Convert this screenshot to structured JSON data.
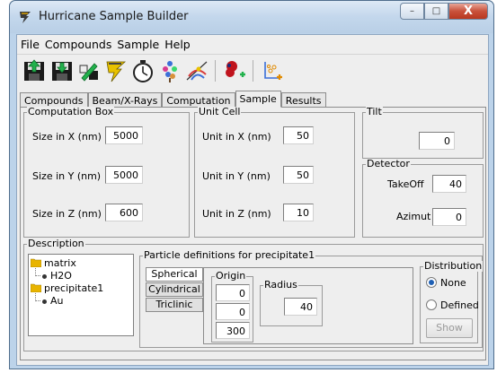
{
  "window": {
    "title": "Hurricane Sample Builder",
    "app_icon": "hurricane-logo-icon",
    "caption_buttons": {
      "minimize": "–",
      "maximize": "□",
      "close": "X"
    }
  },
  "menu": [
    "File",
    "Compounds",
    "Sample",
    "Help"
  ],
  "toolbar": [
    {
      "icon": "save-green-icon"
    },
    {
      "icon": "save-black-icon"
    },
    {
      "icon": "edit-green-icon"
    },
    {
      "icon": "hurricane-lightning-icon"
    },
    {
      "icon": "stopwatch-icon"
    },
    {
      "icon": "molecule-tree-icon"
    },
    {
      "icon": "trajectory-icon"
    },
    {
      "icon": "add-particle-icon"
    },
    {
      "icon": "add-distribution-icon"
    }
  ],
  "tabs": [
    "Compounds",
    "Beam/X-Rays",
    "Computation",
    "Sample",
    "Results"
  ],
  "active_tab": "Sample",
  "computation_box": {
    "title": "Computation Box",
    "fields": [
      {
        "label": "Size in X (nm)",
        "value": "5000"
      },
      {
        "label": "Size in Y (nm)",
        "value": "5000"
      },
      {
        "label": "Size in Z (nm)",
        "value": "600"
      }
    ]
  },
  "unit_cell": {
    "title": "Unit Cell",
    "fields": [
      {
        "label": "Unit in X (nm)",
        "value": "50"
      },
      {
        "label": "Unit in Y (nm)",
        "value": "50"
      },
      {
        "label": "Unit in Z (nm)",
        "value": "10"
      }
    ]
  },
  "tilt": {
    "title": "Tilt",
    "value": "0"
  },
  "detector": {
    "title": "Detector",
    "takeoff_label": "TakeOff",
    "takeoff_value": "40",
    "azimut_label": "Azimut",
    "azimut_value": "0"
  },
  "description": {
    "title": "Description",
    "tree": [
      {
        "label": "matrix",
        "children": [
          "H2O"
        ]
      },
      {
        "label": "precipitate1",
        "children": [
          "Au"
        ]
      }
    ]
  },
  "particle": {
    "title": "Particle definitions for precipitate1",
    "shapes": [
      "Spherical",
      "Cylindrical",
      "Triclinic"
    ],
    "active_shape": "Spherical",
    "origin_title": "Origin",
    "origin": [
      "0",
      "0",
      "300"
    ],
    "radius_title": "Radius",
    "radius": "40",
    "distribution_title": "Distribution",
    "distribution_options": [
      "None",
      "Defined"
    ],
    "distribution_selected": "None",
    "show_button": "Show"
  },
  "colors": {
    "titlebar": "#c3d7ec",
    "panel": "#eeeeee",
    "radio_accent": "#1e5fb4",
    "close_button": "#c9513b"
  }
}
